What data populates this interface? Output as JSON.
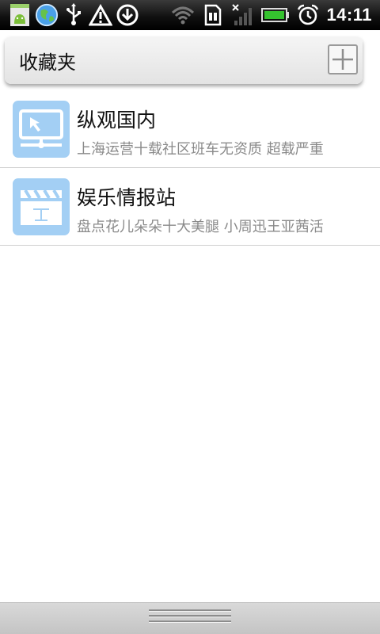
{
  "status_bar": {
    "time": "14:11",
    "icons": [
      "app-notification-icon",
      "browser-globe-icon",
      "usb-icon",
      "warning-icon",
      "download-icon",
      "wifi-icon",
      "sim-card-icon",
      "no-signal-icon",
      "battery-icon",
      "alarm-clock-icon"
    ]
  },
  "header": {
    "title": "收藏夹",
    "add_icon": "plus-icon"
  },
  "items": [
    {
      "title": "纵观国内",
      "subtitle": "上海运营十载社区班车无资质 超载严重",
      "icon": "monitor-icon"
    },
    {
      "title": "娱乐情报站",
      "subtitle": "盘点花儿朵朵十大美腿  小周迅王亚茜活",
      "icon": "clapperboard-icon"
    }
  ],
  "colors": {
    "icon_tile": "#a3cff4",
    "battery": "#35c22f",
    "subtitle": "#8a8a8a"
  }
}
